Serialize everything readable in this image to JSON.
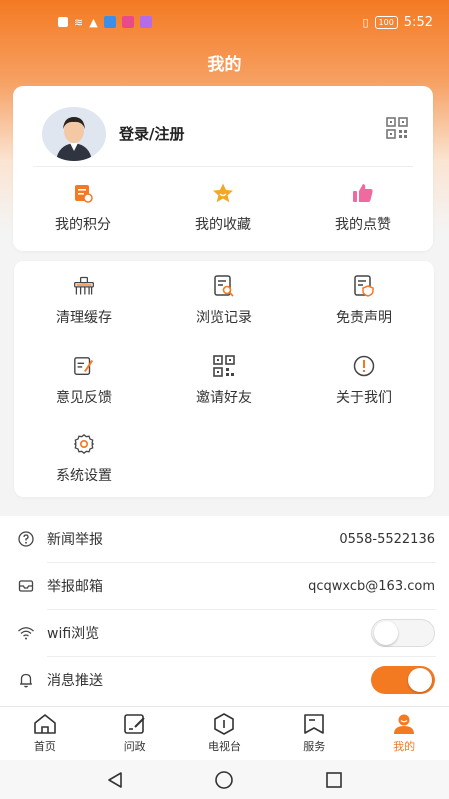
{
  "status_bar": {
    "time": "5:52",
    "battery": "100"
  },
  "page": {
    "title": "我的"
  },
  "profile": {
    "login_label": "登录/注册"
  },
  "quick_actions": [
    {
      "label": "我的积分",
      "icon": "points-icon",
      "color": "#f47a22"
    },
    {
      "label": "我的收藏",
      "icon": "star-icon",
      "color": "#f5a623"
    },
    {
      "label": "我的点赞",
      "icon": "thumbs-up-icon",
      "color": "#f06aa0"
    }
  ],
  "tools": [
    {
      "label": "清理缓存",
      "icon": "clear-cache-icon"
    },
    {
      "label": "浏览记录",
      "icon": "history-icon"
    },
    {
      "label": "免责声明",
      "icon": "disclaimer-icon"
    },
    {
      "label": "意见反馈",
      "icon": "feedback-icon"
    },
    {
      "label": "邀请好友",
      "icon": "invite-qr-icon"
    },
    {
      "label": "关于我们",
      "icon": "about-icon"
    },
    {
      "label": "系统设置",
      "icon": "settings-gear-icon"
    }
  ],
  "settings": {
    "news_report": {
      "label": "新闻举报",
      "value": "0558-5522136"
    },
    "report_email": {
      "label": "举报邮箱",
      "value": "qcqwxcb@163.com"
    },
    "wifi_browse": {
      "label": "wifi浏览",
      "enabled": false
    },
    "push": {
      "label": "消息推送",
      "enabled": true
    }
  },
  "tabs": [
    {
      "label": "首页",
      "icon": "home-icon",
      "active": false
    },
    {
      "label": "问政",
      "icon": "inquiry-icon",
      "active": false
    },
    {
      "label": "电视台",
      "icon": "tv-icon",
      "active": false
    },
    {
      "label": "服务",
      "icon": "service-icon",
      "active": false
    },
    {
      "label": "我的",
      "icon": "profile-icon",
      "active": true
    }
  ],
  "colors": {
    "accent": "#f47a22"
  }
}
